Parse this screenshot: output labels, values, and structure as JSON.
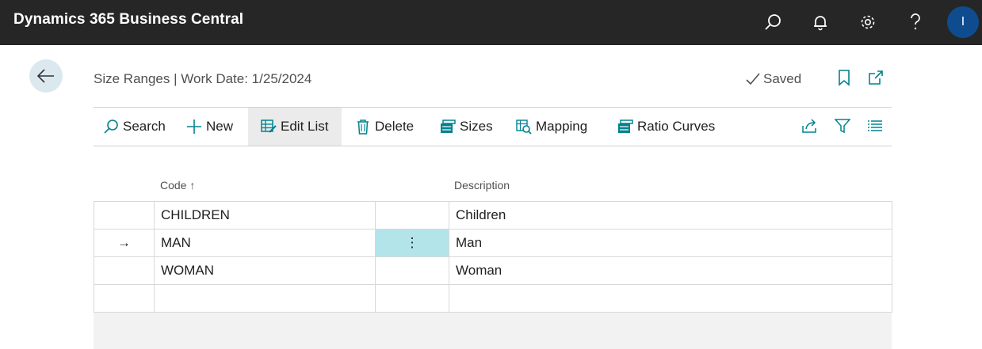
{
  "app": {
    "title": "Dynamics 365 Business Central",
    "avatar_initial": "I"
  },
  "topbar_icons": [
    "search-icon",
    "bell-icon",
    "gear-icon",
    "help-icon"
  ],
  "page": {
    "title": "Size Ranges | Work Date: 1/25/2024",
    "status": "Saved"
  },
  "actions": {
    "search": "Search",
    "new": "New",
    "edit_list": "Edit List",
    "delete": "Delete",
    "sizes": "Sizes",
    "mapping": "Mapping",
    "ratio_curves": "Ratio Curves"
  },
  "table": {
    "columns": {
      "code": "Code",
      "description": "Description"
    },
    "sort_indicator": "↑",
    "rows": [
      {
        "code": "CHILDREN",
        "description": "Children"
      },
      {
        "code": "MAN",
        "description": "Man"
      },
      {
        "code": "WOMAN",
        "description": "Woman"
      },
      {
        "code": "",
        "description": ""
      }
    ],
    "selected_row_marker": "→",
    "row_menu": "⋮"
  },
  "colors": {
    "topbar": "#262626",
    "avatar": "#0f4c8f",
    "accent": "#00838f",
    "selected_cell": "#b3e4ea"
  }
}
